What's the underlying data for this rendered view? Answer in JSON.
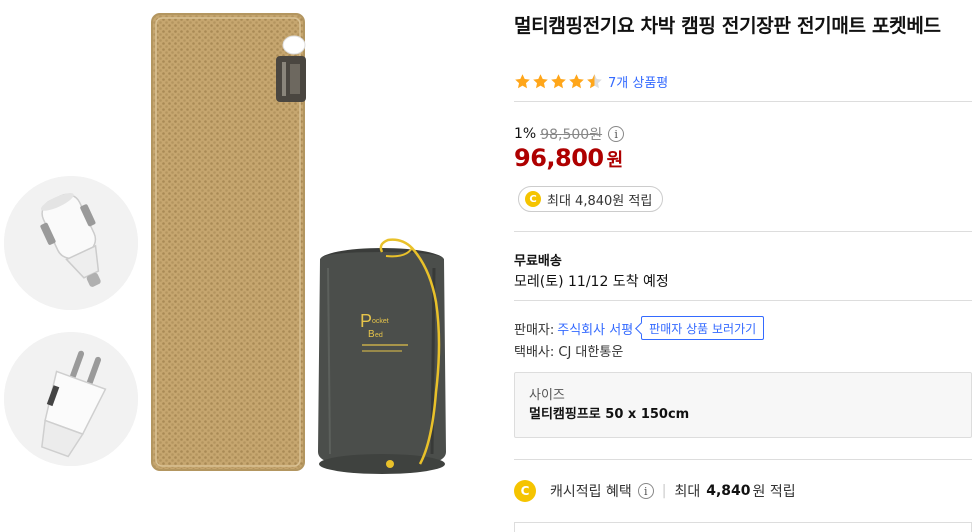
{
  "product": {
    "title": "멀티캠핑전기요 차박 캠핑 전기장판 전기매트 포켓베드",
    "rating_stars": 4.5,
    "review_count_label": "7개 상품평",
    "discount_rate": "1%",
    "original_price": "98,500원",
    "sale_price": "96,800",
    "sale_unit": "원",
    "info_icon": "i",
    "cash_badge": "최대 4,840원 적립",
    "coin_letter": "C"
  },
  "shipping": {
    "label": "무료배송",
    "eta": "모레(토) 11/12 도착 예정"
  },
  "seller": {
    "label": "판매자:",
    "name": "주식회사 서평",
    "button": "판매자 상품 보러가기",
    "courier": "택배사: CJ 대한통운"
  },
  "option": {
    "label": "사이즈",
    "value": "멀티캠핑프로 50 x 150cm"
  },
  "cashback": {
    "label": "캐시적립 혜택",
    "prefix": "최대",
    "amount": "4,840",
    "suffix": "원 적립"
  },
  "image": {
    "pouch_brand_line1": "ocket",
    "pouch_brand_line2": "ed",
    "pouch_brand_initial": "P",
    "pouch_brand_initial2": "B"
  },
  "colors": {
    "accent_blue": "#346aff",
    "price_red": "#ae0000",
    "star_orange": "#ffa61a",
    "coin_yellow": "#f5c400",
    "mat_tan": "#c6a66f"
  }
}
